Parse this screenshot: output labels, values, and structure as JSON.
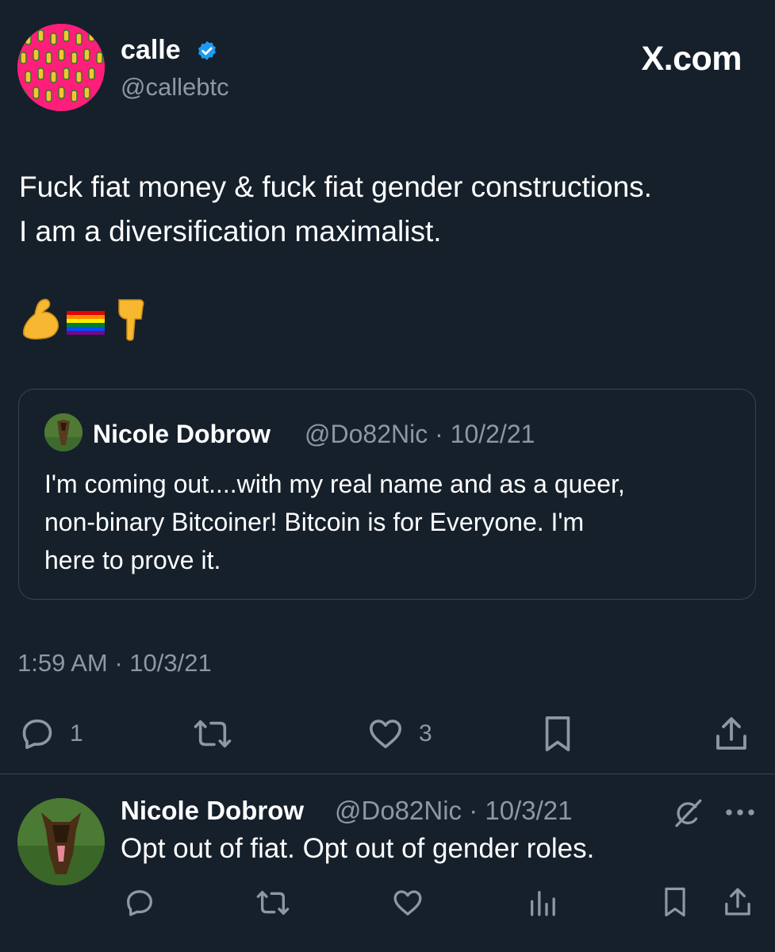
{
  "tweet": {
    "author_name": "calle",
    "author_handle": "@callebtc",
    "site_label": "X.com",
    "text_line1": "Fuck fiat money & fuck fiat gender constructions.",
    "text_line2": "I am a diversification maximalist.",
    "emojis": [
      "flexed-biceps",
      "rainbow-flag",
      "pointing-down"
    ],
    "timestamp": "1:59 AM · 10/3/21",
    "reply_count": "1",
    "like_count": "3"
  },
  "quote": {
    "author_name": "Nicole Dobrow",
    "meta": "@Do82Nic · 10/2/21",
    "text_line1": "I'm coming out....with my real name and as a queer,",
    "text_line2": "non-binary Bitcoiner! Bitcoin is for Everyone. I'm",
    "text_line3": "here to  prove it."
  },
  "reply": {
    "author_name": "Nicole Dobrow",
    "meta": "@Do82Nic · 10/3/21",
    "text": "Opt out of fiat. Opt out of gender roles."
  },
  "colors": {
    "background": "#15202b",
    "muted_text": "#8b98a5",
    "verified_blue": "#1d9bf0",
    "border": "#38444d"
  }
}
